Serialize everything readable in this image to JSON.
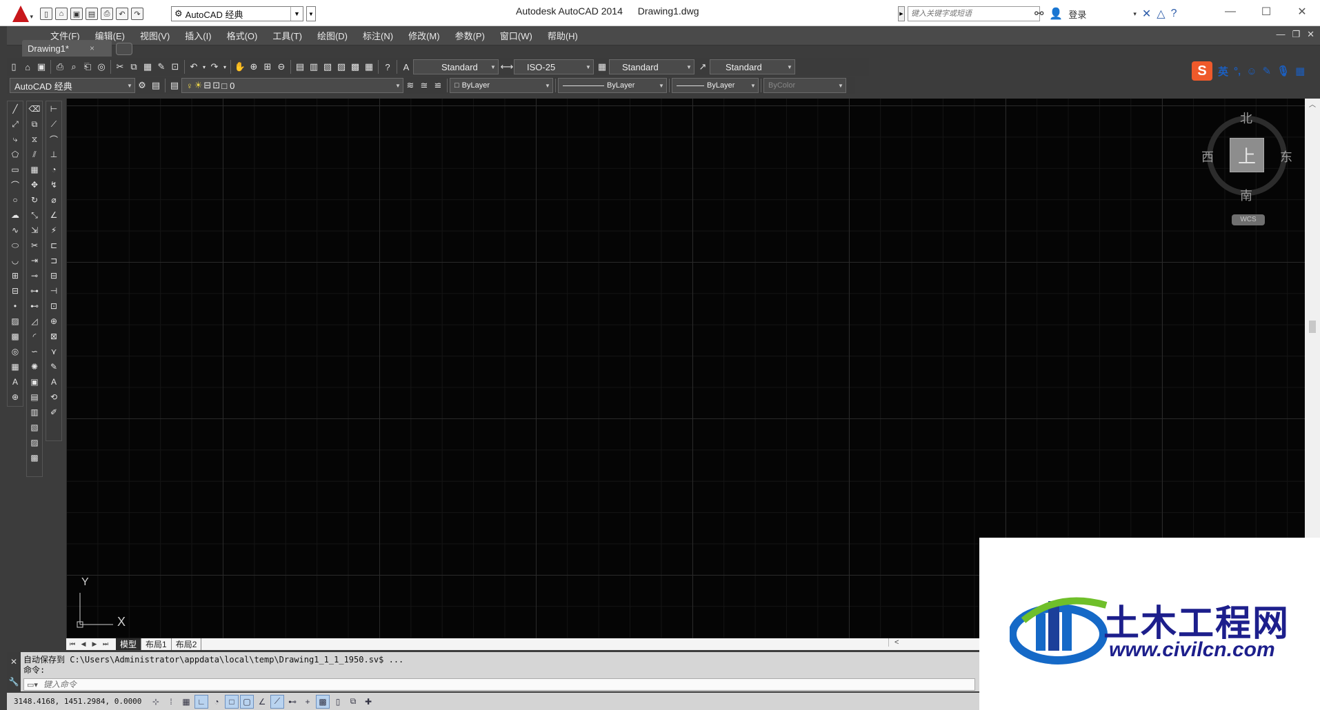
{
  "title_bar": {
    "workspace": "AutoCAD 经典",
    "app_name": "Autodesk AutoCAD 2014",
    "file_name": "Drawing1.dwg",
    "help_search_placeholder": "键入关键字或短语",
    "sign_in": "登录"
  },
  "menu": [
    "文件(F)",
    "编辑(E)",
    "视图(V)",
    "插入(I)",
    "格式(O)",
    "工具(T)",
    "绘图(D)",
    "标注(N)",
    "修改(M)",
    "参数(P)",
    "窗口(W)",
    "帮助(H)"
  ],
  "document_tab": {
    "label": "Drawing1*",
    "close": "×"
  },
  "styles": {
    "text_style": "Standard",
    "dim_style": "ISO-25",
    "table_style": "Standard",
    "multileader_style": "Standard"
  },
  "workspace_toolbar": {
    "workspace": "AutoCAD 经典"
  },
  "layer": {
    "current": "0"
  },
  "properties": {
    "color": "ByLayer",
    "linetype": "ByLayer",
    "lineweight": "ByLayer",
    "plotstyle": "ByColor"
  },
  "ime": {
    "lang": "英"
  },
  "viewcube": {
    "north": "北",
    "south": "南",
    "west": "西",
    "east": "东",
    "face": "上",
    "wcs": "WCS"
  },
  "ucs": {
    "x": "X",
    "y": "Y"
  },
  "layout_tabs": [
    "模型",
    "布局1",
    "布局2"
  ],
  "command": {
    "history_line1": "自动保存到 C:\\Users\\Administrator\\appdata\\local\\temp\\Drawing1_1_1_1950.sv$ ...",
    "history_line2": "命令:",
    "input_placeholder": "键入命令"
  },
  "status": {
    "coords": "3148.4168, 1451.2984, 0.0000"
  },
  "watermark": {
    "name": "土木工程网",
    "url": "www.civilcn.com"
  }
}
